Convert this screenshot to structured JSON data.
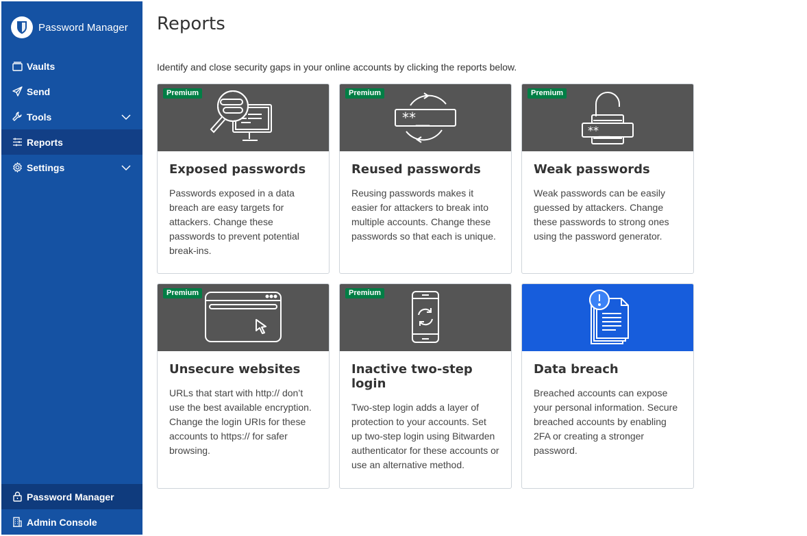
{
  "app": {
    "name": "Password Manager"
  },
  "nav": {
    "items": [
      {
        "label": "Vaults",
        "icon": "vault-icon"
      },
      {
        "label": "Send",
        "icon": "send-icon"
      },
      {
        "label": "Tools",
        "icon": "wrench-icon",
        "expandable": true
      },
      {
        "label": "Reports",
        "icon": "sliders-icon",
        "active": true
      },
      {
        "label": "Settings",
        "icon": "gear-icon",
        "expandable": true
      }
    ],
    "bottom": [
      {
        "label": "Password Manager",
        "icon": "lock-icon",
        "active": true
      },
      {
        "label": "Admin Console",
        "icon": "building-icon"
      }
    ]
  },
  "page": {
    "title": "Reports",
    "description": "Identify and close security gaps in your online accounts by clicking the reports below."
  },
  "badge_label": "Premium",
  "reports": [
    {
      "title": "Exposed passwords",
      "text": "Passwords exposed in a data breach are easy targets for attackers. Change these passwords to prevent potential break-ins.",
      "premium": true,
      "icon": "magnifier-monitor-icon"
    },
    {
      "title": "Reused passwords",
      "text": "Reusing passwords makes it easier for attackers to break into multiple accounts. Change these passwords so that each is unique.",
      "premium": true,
      "icon": "recycle-password-icon"
    },
    {
      "title": "Weak passwords",
      "text": "Weak passwords can be easily guessed by attackers. Change these passwords to strong ones using the password generator.",
      "premium": true,
      "icon": "padlock-password-icon"
    },
    {
      "title": "Unsecure websites",
      "text": "URLs that start with http:// don’t use the best available encryption. Change the login URIs for these accounts to https:// for safer browsing.",
      "premium": true,
      "icon": "browser-cursor-icon"
    },
    {
      "title": "Inactive two-step login",
      "text": "Two-step login adds a layer of protection to your accounts. Set up two-step login using Bitwarden authenticator for these accounts or use an alternative method.",
      "premium": true,
      "icon": "phone-sync-icon"
    },
    {
      "title": "Data breach",
      "text": "Breached accounts can expose your personal information. Secure breached accounts by enabling 2FA or creating a stronger password.",
      "premium": false,
      "icon": "alert-documents-icon"
    }
  ],
  "colors": {
    "sidebar": "#1552a3",
    "sidebar_active": "#123f86",
    "card_header": "#555555",
    "card_header_highlight": "#175ddc",
    "premium_badge": "#017e45"
  }
}
